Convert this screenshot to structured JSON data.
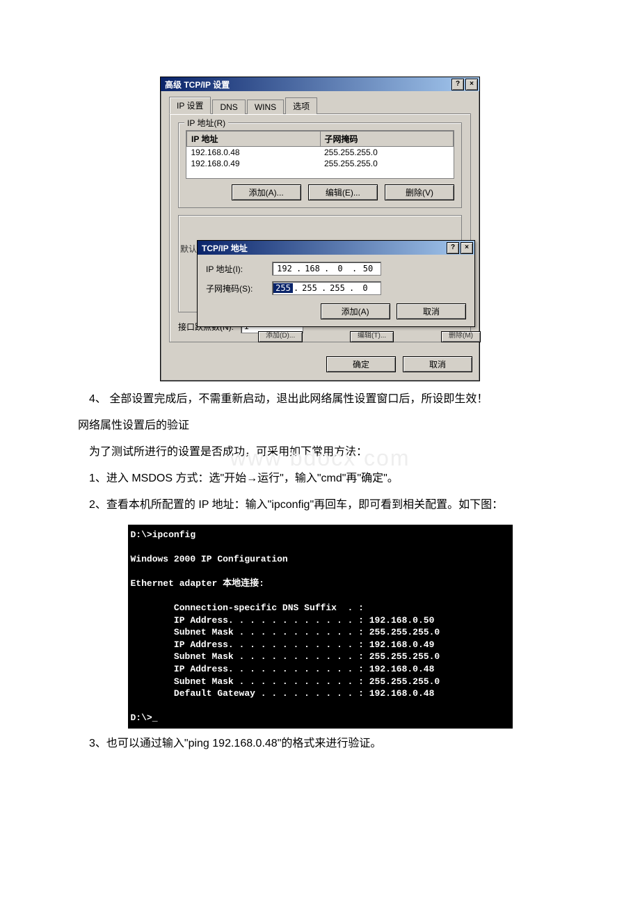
{
  "dialog": {
    "title": "高级 TCP/IP 设置",
    "help_btn": "?",
    "close_btn": "×",
    "tabs": {
      "ip": "IP 设置",
      "dns": "DNS",
      "wins": "WINS",
      "options": "选项"
    },
    "ip_group_legend": "IP 地址(R)",
    "table_headers": {
      "ip": "IP 地址",
      "mask": "子网掩码"
    },
    "table_rows": [
      {
        "ip": "192.168.0.48",
        "mask": "255.255.255.0"
      },
      {
        "ip": "192.168.0.49",
        "mask": "255.255.255.0"
      }
    ],
    "buttons": {
      "add": "添加(A)...",
      "edit": "编辑(E)...",
      "remove": "删除(V)"
    },
    "default_label_cut": "默认",
    "behind": {
      "add": "添加(D)...",
      "edit": "编辑(T)...",
      "remove": "删除(M)"
    },
    "hop_label": "接口跃点数(N):",
    "hop_value": "1",
    "ok": "确定",
    "cancel": "取消"
  },
  "sub_dialog": {
    "title": "TCP/IP 地址",
    "help_btn": "?",
    "close_btn": "×",
    "ip_label": "IP 地址(I):",
    "mask_label": "子网掩码(S):",
    "ip_octets": [
      "192",
      "168",
      "0",
      "50"
    ],
    "mask_octets": [
      "255",
      "255",
      "255",
      "0"
    ],
    "add": "添加(A)",
    "cancel": "取消"
  },
  "doc": {
    "p4": "4、 全部设置完成后，不需重新启动，退出此网络属性设置窗口后，所设即生效！",
    "h_verify": "网络属性设置后的验证",
    "p_intro": "为了测试所进行的设置是否成功，可采用如下常用方法：",
    "p1": "1、进入 MSDOS 方式：选\"开始→运行\"，输入\"cmd\"再\"确定\"。",
    "p2": "2、查看本机所配置的 IP 地址：输入\"ipconfig\"再回车，即可看到相关配置。如下图：",
    "p3": "3、也可以通过输入\"ping 192.168.0.48\"的格式来进行验证。",
    "watermark": "www bdocx com"
  },
  "console": {
    "lines": [
      "D:\\>ipconfig",
      "",
      "Windows 2000 IP Configuration",
      "",
      "Ethernet adapter 本地连接:",
      "",
      "        Connection-specific DNS Suffix  . :",
      "        IP Address. . . . . . . . . . . . : 192.168.0.50",
      "        Subnet Mask . . . . . . . . . . . : 255.255.255.0",
      "        IP Address. . . . . . . . . . . . : 192.168.0.49",
      "        Subnet Mask . . . . . . . . . . . : 255.255.255.0",
      "        IP Address. . . . . . . . . . . . : 192.168.0.48",
      "        Subnet Mask . . . . . . . . . . . : 255.255.255.0",
      "        Default Gateway . . . . . . . . . : 192.168.0.48",
      "",
      "D:\\>_"
    ]
  }
}
